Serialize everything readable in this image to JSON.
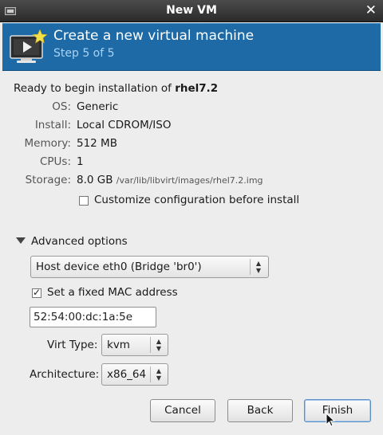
{
  "window": {
    "title": "New VM"
  },
  "banner": {
    "heading": "Create a new virtual machine",
    "step": "Step 5 of 5"
  },
  "summary": {
    "ready_prefix": "Ready to begin installation of ",
    "vm_name": "rhel7.2",
    "os_label": "OS:",
    "os_value": "Generic",
    "install_label": "Install:",
    "install_value": "Local CDROM/ISO",
    "memory_label": "Memory:",
    "memory_value": "512 MB",
    "cpus_label": "CPUs:",
    "cpus_value": "1",
    "storage_label": "Storage:",
    "storage_value": "8.0 GB",
    "storage_path": "/var/lib/libvirt/images/rhel7.2.img"
  },
  "customize": {
    "label": "Customize configuration before install",
    "checked": false
  },
  "advanced": {
    "label": "Advanced options",
    "network": "Host device eth0 (Bridge 'br0')",
    "mac_label": "Set a fixed MAC address",
    "mac_checked": true,
    "mac_value": "52:54:00:dc:1a:5e",
    "virt_type_label": "Virt Type:",
    "virt_type_value": "kvm",
    "arch_label": "Architecture:",
    "arch_value": "x86_64"
  },
  "buttons": {
    "cancel": "Cancel",
    "back": "Back",
    "finish": "Finish"
  },
  "colors": {
    "banner": "#1d6aa6",
    "step_text": "#a9d3f5",
    "titlebar": "#3a3a3a"
  }
}
